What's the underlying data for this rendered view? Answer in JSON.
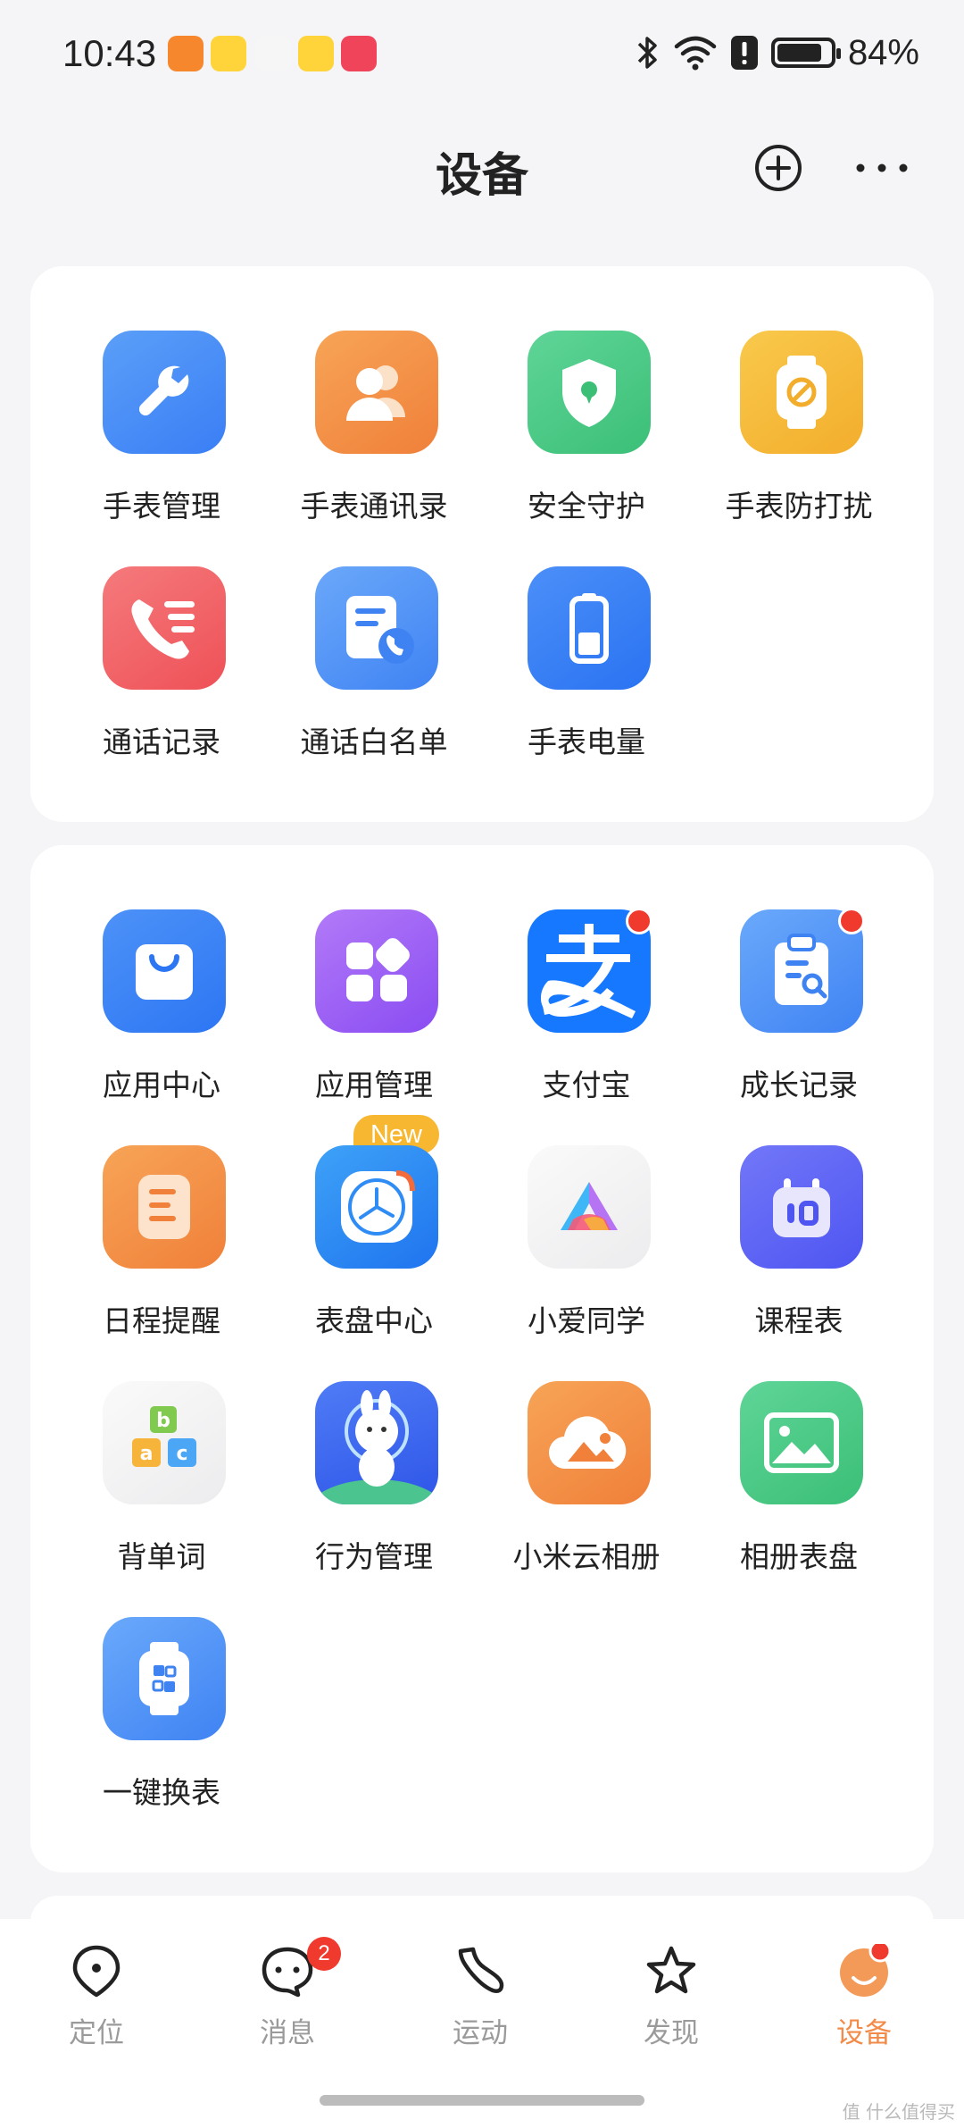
{
  "status_bar": {
    "time": "10:43",
    "battery_pct": "84%",
    "battery_level": 0.84
  },
  "header": {
    "title": "设备"
  },
  "card1": {
    "items": [
      {
        "label": "手表管理",
        "icon": "wrench-icon",
        "color": "#4a8ff7"
      },
      {
        "label": "手表通讯录",
        "icon": "contacts-icon",
        "color": "#f28c3c"
      },
      {
        "label": "安全守护",
        "icon": "shield-icon",
        "color": "#45c680"
      },
      {
        "label": "手表防打扰",
        "icon": "do-not-disturb-watch-icon",
        "color": "#f5b531"
      },
      {
        "label": "通话记录",
        "icon": "phone-log-icon",
        "color": "#f05a5f"
      },
      {
        "label": "通话白名单",
        "icon": "whitelist-icon",
        "color": "#4a8ff7"
      },
      {
        "label": "手表电量",
        "icon": "battery-icon",
        "color": "#2f7af3"
      }
    ]
  },
  "card2": {
    "new_badge": "New",
    "items": [
      {
        "label": "应用中心",
        "icon": "app-store-bag-icon",
        "color": "#3a7ef6"
      },
      {
        "label": "应用管理",
        "icon": "app-grid-icon",
        "color": "#9b5cf5"
      },
      {
        "label": "支付宝",
        "icon": "alipay-icon",
        "color": "#1677ff"
      },
      {
        "label": "成长记录",
        "icon": "clipboard-search-icon",
        "color": "#4a8ff7"
      },
      {
        "label": "日程提醒",
        "icon": "schedule-note-icon",
        "color": "#f28c3c"
      },
      {
        "label": "表盘中心",
        "icon": "watch-face-icon",
        "color": "#2f8cf5"
      },
      {
        "label": "小爱同学",
        "icon": "xiaoai-icon",
        "color": "#f2f2f4"
      },
      {
        "label": "课程表",
        "icon": "timetable-icon",
        "color": "#5b62f5"
      },
      {
        "label": "背单词",
        "icon": "abc-blocks-icon",
        "color": "#f2f2f4"
      },
      {
        "label": "行为管理",
        "icon": "bunny-astronaut-icon",
        "color": "#3c6cf2"
      },
      {
        "label": "小米云相册",
        "icon": "cloud-album-icon",
        "color": "#f28c3c"
      },
      {
        "label": "相册表盘",
        "icon": "photo-icon",
        "color": "#45c680"
      },
      {
        "label": "一键换表",
        "icon": "watch-switch-icon",
        "color": "#4a8ff7"
      }
    ]
  },
  "tabbar": {
    "tabs": [
      {
        "label": "定位",
        "icon": "location-pin-icon"
      },
      {
        "label": "消息",
        "icon": "chat-bubble-icon",
        "badge": "2"
      },
      {
        "label": "运动",
        "icon": "shoe-icon"
      },
      {
        "label": "发现",
        "icon": "star-icon"
      },
      {
        "label": "设备",
        "icon": "avatar-device-icon",
        "active": true
      }
    ]
  },
  "watermark": "值 什么值得买"
}
